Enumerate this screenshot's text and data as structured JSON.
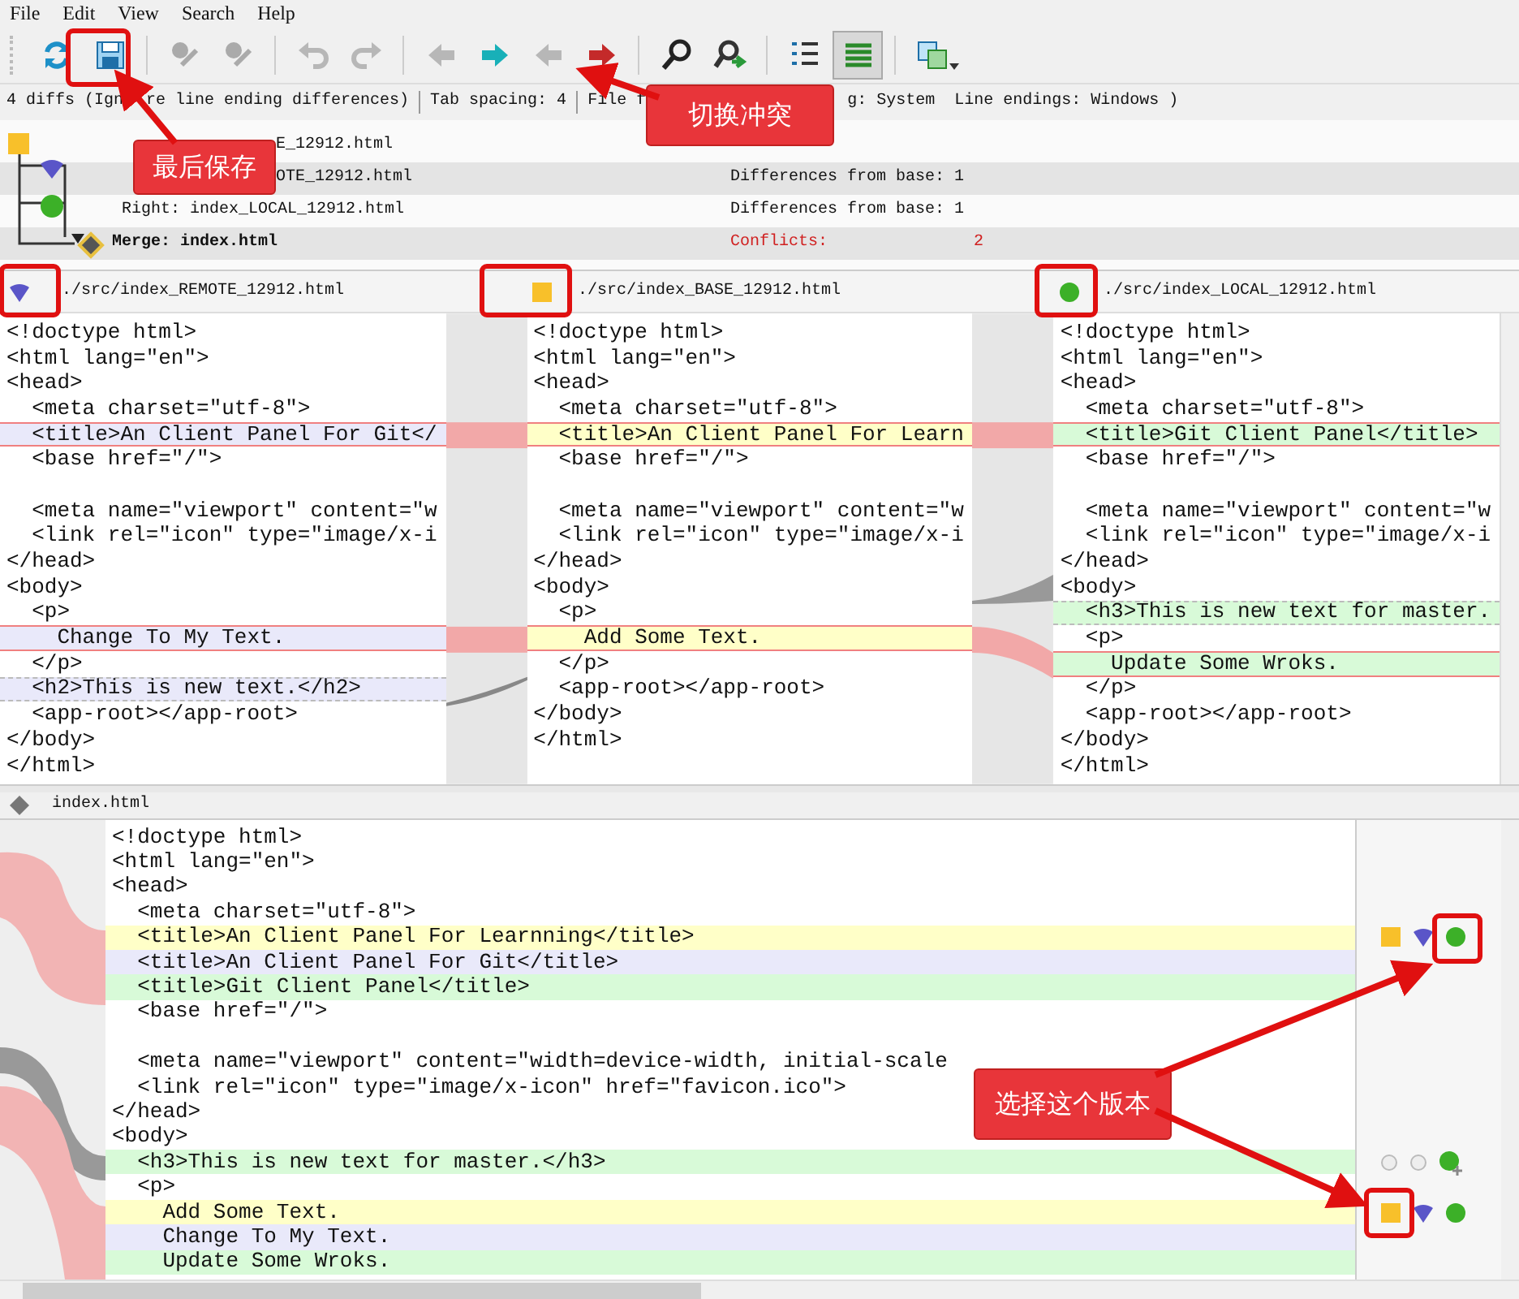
{
  "menu": [
    "File",
    "Edit",
    "View",
    "Search",
    "Help"
  ],
  "toolbar": [
    {
      "kind": "refresh",
      "disabled": false,
      "pressed": false
    },
    {
      "kind": "save",
      "disabled": false,
      "pressed": false
    },
    {
      "kind": "sep"
    },
    {
      "kind": "mark",
      "disabled": true,
      "pressed": false
    },
    {
      "kind": "unmark",
      "disabled": true,
      "pressed": false
    },
    {
      "kind": "sep"
    },
    {
      "kind": "undo",
      "disabled": true,
      "pressed": false
    },
    {
      "kind": "redo",
      "disabled": true,
      "pressed": false
    },
    {
      "kind": "sep"
    },
    {
      "kind": "prev-diff",
      "disabled": true,
      "pressed": false
    },
    {
      "kind": "next-diff",
      "disabled": false,
      "pressed": false
    },
    {
      "kind": "prev-conflict",
      "disabled": true,
      "pressed": false
    },
    {
      "kind": "next-conflict",
      "disabled": false,
      "pressed": false
    },
    {
      "kind": "sep"
    },
    {
      "kind": "find",
      "disabled": false,
      "pressed": false
    },
    {
      "kind": "find-next",
      "disabled": false,
      "pressed": false
    },
    {
      "kind": "sep"
    },
    {
      "kind": "line-numbers",
      "disabled": false,
      "pressed": false
    },
    {
      "kind": "layout",
      "disabled": false,
      "pressed": true
    },
    {
      "kind": "sep"
    },
    {
      "kind": "windows",
      "disabled": false,
      "pressed": false
    }
  ],
  "status": [
    "4 diffs (Ign",
    "re line ending differences)",
    "Tab spacing: 4",
    "File f",
    "g: System",
    "Line endings: Windows )"
  ],
  "files": [
    {
      "kind": "base",
      "name": "E_12912.html"
    },
    {
      "kind": "remote",
      "name": "OTE_12912.html",
      "note": "Differences from base: 1"
    },
    {
      "kind": "local",
      "name": "Right: index_LOCAL_12912.html",
      "note": "Differences from base: 1"
    },
    {
      "kind": "merge",
      "name": "Merge: index.html",
      "note": "Conflicts:",
      "count": "2"
    }
  ],
  "panes": [
    {
      "kind": "remote",
      "path": "./src/index_REMOTE_12912.html",
      "lines": [
        {
          "kind": "plain",
          "text": "<!doctype html>"
        },
        {
          "kind": "plain",
          "text": "<html lang=\"en\">"
        },
        {
          "kind": "plain",
          "text": "<head>"
        },
        {
          "kind": "plain",
          "text": "  <meta charset=\"utf-8\">"
        },
        {
          "kind": "conflict",
          "text": "  <title>An Client Panel For Git</"
        },
        {
          "kind": "plain",
          "text": "  <base href=\"/\">"
        },
        {
          "kind": "blank"
        },
        {
          "kind": "plain",
          "text": "  <meta name=\"viewport\" content=\"w"
        },
        {
          "kind": "plain",
          "text": "  <link rel=\"icon\" type=\"image/x-i"
        },
        {
          "kind": "plain",
          "text": "</head>"
        },
        {
          "kind": "plain",
          "text": "<body>"
        },
        {
          "kind": "plain",
          "text": "  <p>"
        },
        {
          "kind": "conflict",
          "text": "    Change To My Text."
        },
        {
          "kind": "plain",
          "text": "  </p>"
        },
        {
          "kind": "changed",
          "text": "  <h2>This is new text.</h2>"
        },
        {
          "kind": "plain",
          "text": "  <app-root></app-root>"
        },
        {
          "kind": "plain",
          "text": "</body>"
        },
        {
          "kind": "plain",
          "text": "</html>"
        }
      ]
    },
    {
      "kind": "base",
      "path": "./src/index_BASE_12912.html",
      "lines": [
        {
          "kind": "plain",
          "text": "<!doctype html>"
        },
        {
          "kind": "plain",
          "text": "<html lang=\"en\">"
        },
        {
          "kind": "plain",
          "text": "<head>"
        },
        {
          "kind": "plain",
          "text": "  <meta charset=\"utf-8\">"
        },
        {
          "kind": "conflict",
          "text": "  <title>An Client Panel For Learn"
        },
        {
          "kind": "plain",
          "text": "  <base href=\"/\">"
        },
        {
          "kind": "blank"
        },
        {
          "kind": "plain",
          "text": "  <meta name=\"viewport\" content=\"w"
        },
        {
          "kind": "plain",
          "text": "  <link rel=\"icon\" type=\"image/x-i"
        },
        {
          "kind": "plain",
          "text": "</head>"
        },
        {
          "kind": "plain",
          "text": "<body>"
        },
        {
          "kind": "plain",
          "text": "  <p>"
        },
        {
          "kind": "conflict",
          "text": "    Add Some Text."
        },
        {
          "kind": "plain",
          "text": "  </p>"
        },
        {
          "kind": "plain",
          "text": "  <app-root></app-root>"
        },
        {
          "kind": "plain",
          "text": "</body>"
        },
        {
          "kind": "plain",
          "text": "</html>"
        }
      ]
    },
    {
      "kind": "local",
      "path": "./src/index_LOCAL_12912.html",
      "lines": [
        {
          "kind": "plain",
          "text": "<!doctype html>"
        },
        {
          "kind": "plain",
          "text": "<html lang=\"en\">"
        },
        {
          "kind": "plain",
          "text": "<head>"
        },
        {
          "kind": "plain",
          "text": "  <meta charset=\"utf-8\">"
        },
        {
          "kind": "conflict",
          "text": "  <title>Git Client Panel</title>"
        },
        {
          "kind": "plain",
          "text": "  <base href=\"/\">"
        },
        {
          "kind": "blank"
        },
        {
          "kind": "plain",
          "text": "  <meta name=\"viewport\" content=\"w"
        },
        {
          "kind": "plain",
          "text": "  <link rel=\"icon\" type=\"image/x-i"
        },
        {
          "kind": "plain",
          "text": "</head>"
        },
        {
          "kind": "plain",
          "text": "<body>"
        },
        {
          "kind": "changed",
          "text": "  <h3>This is new text for master."
        },
        {
          "kind": "plain",
          "text": "  <p>"
        },
        {
          "kind": "conflict",
          "text": "    Update Some Wroks."
        },
        {
          "kind": "plain",
          "text": "  </p>"
        },
        {
          "kind": "plain",
          "text": "  <app-root></app-root>"
        },
        {
          "kind": "plain",
          "text": "</body>"
        },
        {
          "kind": "plain",
          "text": "</html>"
        }
      ]
    }
  ],
  "merge": {
    "title": "index.html",
    "lines": [
      {
        "kind": "plain",
        "text": "<!doctype html>"
      },
      {
        "kind": "plain",
        "text": "<html lang=\"en\">"
      },
      {
        "kind": "plain",
        "text": "<head>"
      },
      {
        "kind": "plain",
        "text": "  <meta charset=\"utf-8\">"
      },
      {
        "kind": "base",
        "text": "  <title>An Client Panel For Learnning</title>",
        "choices": [
          {
            "kind": "base"
          },
          {
            "kind": "remote"
          },
          {
            "kind": "local"
          }
        ]
      },
      {
        "kind": "remote",
        "text": "  <title>An Client Panel For Git</title>"
      },
      {
        "kind": "local",
        "text": "  <title>Git Client Panel</title>"
      },
      {
        "kind": "plain",
        "text": "  <base href=\"/\">"
      },
      {
        "kind": "blank"
      },
      {
        "kind": "plain",
        "text": "  <meta name=\"viewport\" content=\"width=device-width, initial-scale"
      },
      {
        "kind": "plain",
        "text": "  <link rel=\"icon\" type=\"image/x-icon\" href=\"favicon.ico\">"
      },
      {
        "kind": "plain",
        "text": "</head>"
      },
      {
        "kind": "plain",
        "text": "<body>"
      },
      {
        "kind": "local",
        "text": "  <h3>This is new text for master.</h3>",
        "choices": [
          {
            "kind": "off"
          },
          {
            "kind": "off"
          },
          {
            "kind": "add"
          }
        ]
      },
      {
        "kind": "plain",
        "text": "  <p>"
      },
      {
        "kind": "base",
        "text": "    Add Some Text.",
        "choices": [
          {
            "kind": "base"
          },
          {
            "kind": "remote"
          },
          {
            "kind": "local"
          }
        ]
      },
      {
        "kind": "remote",
        "text": "    Change To My Text."
      },
      {
        "kind": "local",
        "text": "    Update Some Wroks."
      }
    ]
  },
  "callouts": [
    "最后保存",
    "切换冲突",
    "选择这个版本"
  ]
}
